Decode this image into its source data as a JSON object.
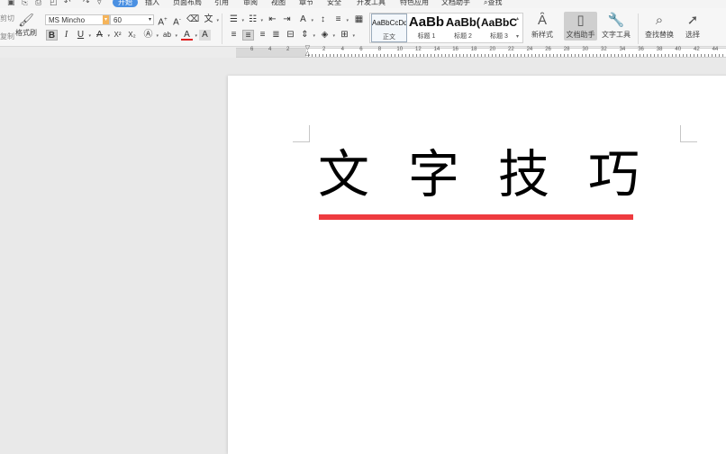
{
  "menu": {
    "items": [
      "开始",
      "插入",
      "页面布局",
      "引用",
      "审阅",
      "视图",
      "章节",
      "安全",
      "开发工具",
      "特色应用",
      "文档助手",
      "查找"
    ],
    "active": "开始"
  },
  "toolbar": {
    "format_painter": "格式刷",
    "font_name": "MS Mincho",
    "font_size": "60",
    "bold": "B",
    "italic": "I",
    "underline": "U",
    "strikethrough": "A",
    "superscript": "X²",
    "subscript": "X₂",
    "font_color_letter": "A",
    "styles": [
      {
        "sample": "AaBbCcDd",
        "name": "正文"
      },
      {
        "sample": "AaBb",
        "name": "标题 1"
      },
      {
        "sample": "AaBb(",
        "name": "标题 2"
      },
      {
        "sample": "AaBbC",
        "name": "标题 3"
      }
    ],
    "new_style": "新样式",
    "doc_assistant": "文档助手",
    "text_tools": "文字工具",
    "find_replace": "查找替换",
    "select": "选择",
    "left_cut_1": "剪切",
    "left_cut_2": "复制"
  },
  "ruler": {
    "numbers": [
      "6",
      "4",
      "2",
      "2",
      "4",
      "6",
      "8",
      "10",
      "12",
      "14",
      "16",
      "18",
      "20",
      "22",
      "24",
      "26",
      "28",
      "30",
      "32",
      "34",
      "36",
      "38",
      "40",
      "42",
      "44"
    ]
  },
  "document": {
    "heading": "文字技巧",
    "underline_color": "#ee3b3f"
  },
  "colors": {
    "accent": "#4a90e2",
    "font_color_bar": "#e02020"
  }
}
